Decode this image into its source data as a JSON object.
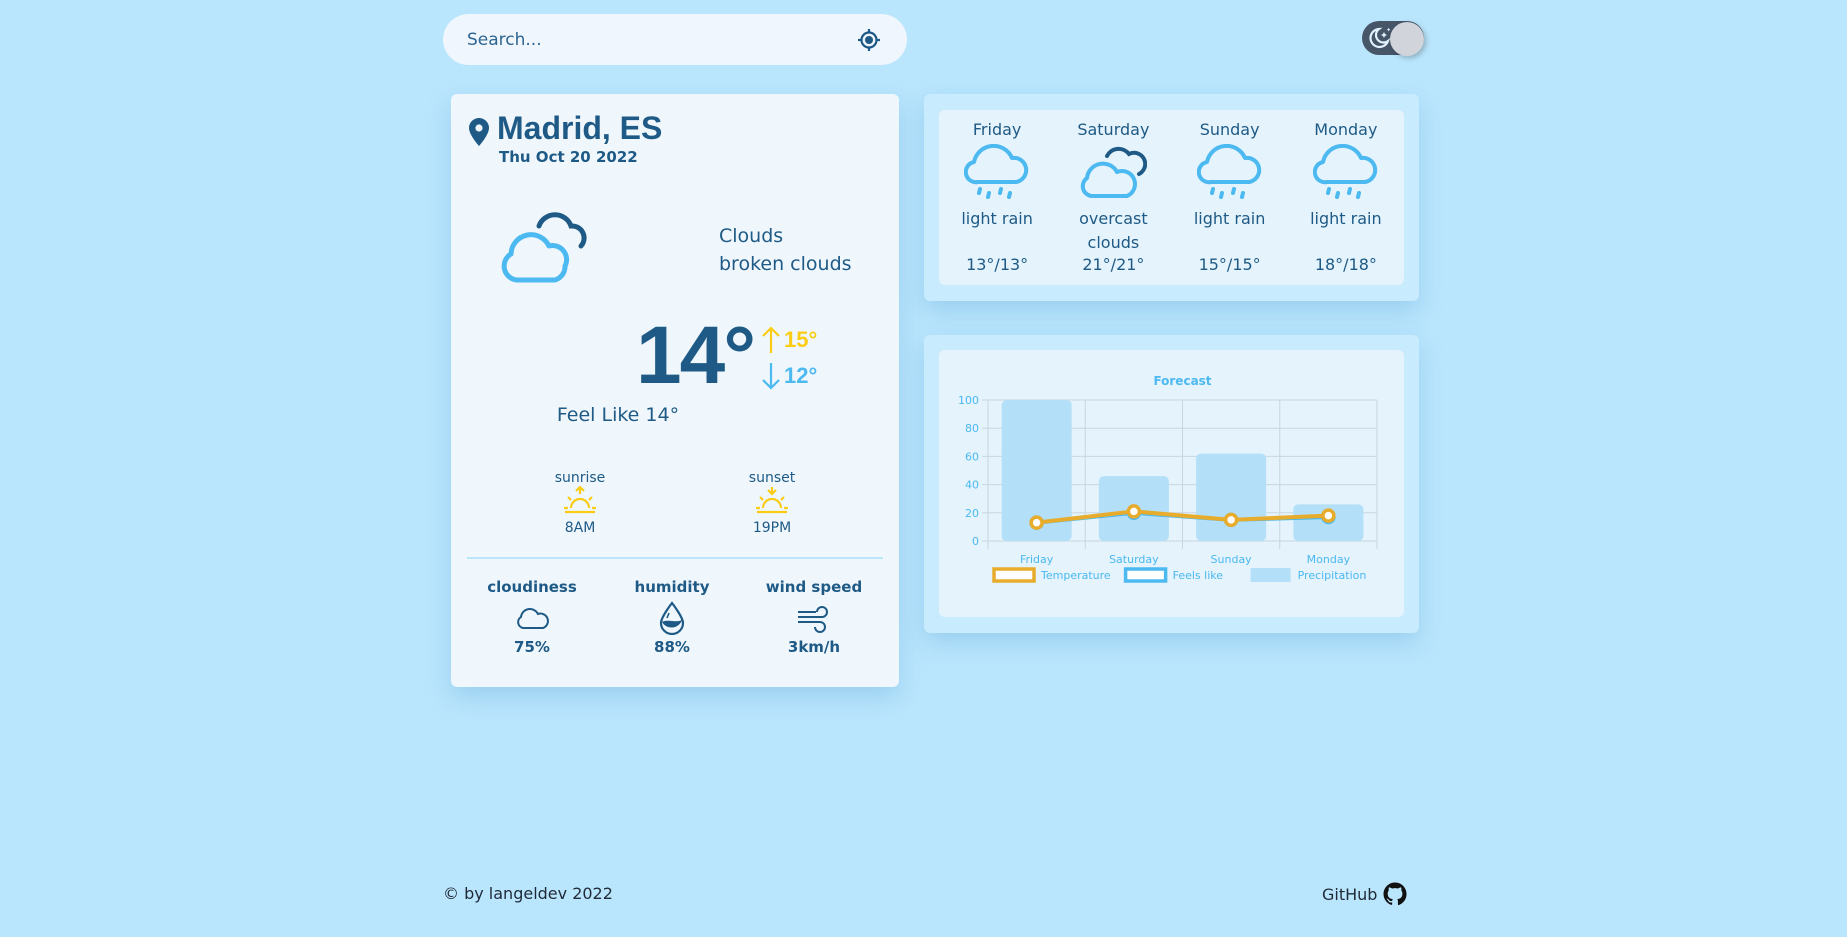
{
  "search": {
    "placeholder": "Search...",
    "value": "",
    "locate_icon": "crosshair-icon"
  },
  "theme_toggle": {
    "mode": "dark",
    "icon": "moon-stars-icon"
  },
  "current": {
    "city": "Madrid, ES",
    "date": "Thu Oct 20 2022",
    "icon": "cloud-broken-icon",
    "main": "Clouds",
    "description": "broken clouds",
    "temp": "14°",
    "temp_max": "15°",
    "temp_min": "12°",
    "feels_like": "Feel Like 14°",
    "sunrise": {
      "label": "sunrise",
      "time": "8AM"
    },
    "sunset": {
      "label": "sunset",
      "time": "19PM"
    },
    "stats": [
      {
        "label": "cloudiness",
        "value": "75%",
        "icon": "cloud-icon"
      },
      {
        "label": "humidity",
        "value": "88%",
        "icon": "droplet-icon"
      },
      {
        "label": "wind speed",
        "value": "3km/h",
        "icon": "wind-icon"
      }
    ]
  },
  "forecast": [
    {
      "day": "Friday",
      "icon": "rain-icon",
      "description": "light rain",
      "temps": "13°/13°"
    },
    {
      "day": "Saturday",
      "icon": "overcast-icon",
      "description": "overcast clouds",
      "temps": "21°/21°"
    },
    {
      "day": "Sunday",
      "icon": "rain-icon",
      "description": "light rain",
      "temps": "15°/15°"
    },
    {
      "day": "Monday",
      "icon": "rain-icon",
      "description": "light rain",
      "temps": "18°/18°"
    }
  ],
  "chart_data": {
    "type": "bar",
    "title": "Forecast",
    "categories": [
      "Friday",
      "Saturday",
      "Sunday",
      "Monday"
    ],
    "ylim": [
      0,
      100
    ],
    "yticks": [
      0,
      20,
      40,
      60,
      80,
      100
    ],
    "grid": true,
    "legend_position": "bottom",
    "series": [
      {
        "name": "Temperature",
        "type": "line",
        "color": "#e8ac2c",
        "values": [
          13,
          21,
          15,
          18
        ]
      },
      {
        "name": "Feels like",
        "type": "line",
        "color": "#4cb9f0",
        "values": [
          13,
          20,
          15,
          17
        ]
      },
      {
        "name": "Precipitation",
        "type": "bar",
        "color": "#b3e0f8",
        "values": [
          100,
          46,
          62,
          26
        ]
      }
    ]
  },
  "footer": {
    "copyright": "© by langeldev 2022",
    "github_label": "GitHub"
  },
  "colors": {
    "background": "#bae6fd",
    "primary_text": "#1e5a85",
    "accent_blue": "#4cb9f0",
    "accent_yellow": "#facc15"
  }
}
